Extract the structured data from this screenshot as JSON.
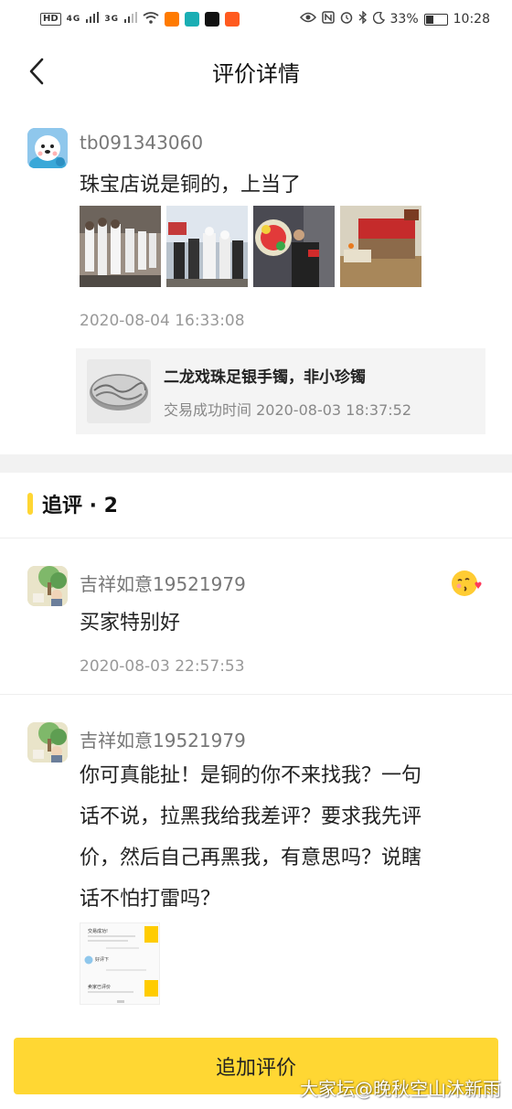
{
  "status_bar": {
    "left_items": [
      "HD",
      "4G",
      "3G"
    ],
    "percent": "33%",
    "time": "10:28"
  },
  "header": {
    "title": "评价详情"
  },
  "review": {
    "username": "tb091343060",
    "text": "珠宝店说是铜的，上当了",
    "date": "2020-08-04 16:33:08",
    "product": {
      "name": "二龙戏珠足银手镯，非小珍镯",
      "trade_time": "交易成功时间 2020-08-03 18:37:52"
    }
  },
  "followup": {
    "section_title": "追评 · 2",
    "items": [
      {
        "username": "吉祥如意19521979",
        "text": "买家特别好",
        "date": "2020-08-03 22:57:53"
      },
      {
        "username": "吉祥如意19521979",
        "lines": [
          "你可真能扯！是铜的你不来找我？一句",
          "话不说，拉黑我给我差评？要求我先评",
          "价，然后自己再黑我，有意思吗？说瞎",
          "话不怕打雷吗？"
        ],
        "attachment": {
          "line1": "交易成功!",
          "line2": "好评下",
          "line3": "卖家已评价"
        }
      }
    ]
  },
  "footer": {
    "button_label": "追加评价",
    "watermark": "大家坛@晚秋空山沐新雨"
  },
  "colors": {
    "accent_yellow": "#ffd733",
    "divider_gray": "#f2f2f2"
  }
}
